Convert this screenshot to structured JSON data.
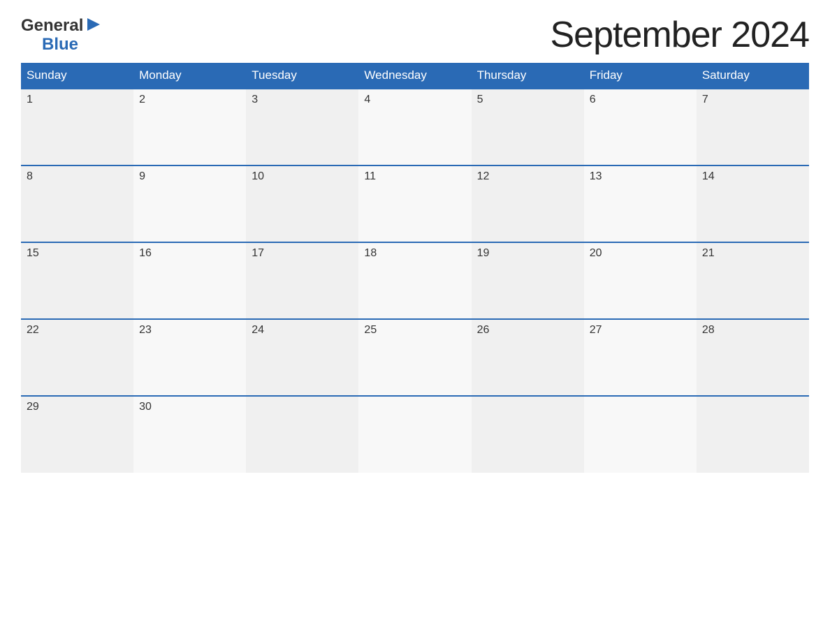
{
  "logo": {
    "general_text": "General",
    "blue_text": "Blue"
  },
  "title": "September 2024",
  "days_of_week": [
    "Sunday",
    "Monday",
    "Tuesday",
    "Wednesday",
    "Thursday",
    "Friday",
    "Saturday"
  ],
  "weeks": [
    [
      {
        "date": "1",
        "empty": false
      },
      {
        "date": "2",
        "empty": false
      },
      {
        "date": "3",
        "empty": false
      },
      {
        "date": "4",
        "empty": false
      },
      {
        "date": "5",
        "empty": false
      },
      {
        "date": "6",
        "empty": false
      },
      {
        "date": "7",
        "empty": false
      }
    ],
    [
      {
        "date": "8",
        "empty": false
      },
      {
        "date": "9",
        "empty": false
      },
      {
        "date": "10",
        "empty": false
      },
      {
        "date": "11",
        "empty": false
      },
      {
        "date": "12",
        "empty": false
      },
      {
        "date": "13",
        "empty": false
      },
      {
        "date": "14",
        "empty": false
      }
    ],
    [
      {
        "date": "15",
        "empty": false
      },
      {
        "date": "16",
        "empty": false
      },
      {
        "date": "17",
        "empty": false
      },
      {
        "date": "18",
        "empty": false
      },
      {
        "date": "19",
        "empty": false
      },
      {
        "date": "20",
        "empty": false
      },
      {
        "date": "21",
        "empty": false
      }
    ],
    [
      {
        "date": "22",
        "empty": false
      },
      {
        "date": "23",
        "empty": false
      },
      {
        "date": "24",
        "empty": false
      },
      {
        "date": "25",
        "empty": false
      },
      {
        "date": "26",
        "empty": false
      },
      {
        "date": "27",
        "empty": false
      },
      {
        "date": "28",
        "empty": false
      }
    ],
    [
      {
        "date": "29",
        "empty": false
      },
      {
        "date": "30",
        "empty": false
      },
      {
        "date": "",
        "empty": true
      },
      {
        "date": "",
        "empty": true
      },
      {
        "date": "",
        "empty": true
      },
      {
        "date": "",
        "empty": true
      },
      {
        "date": "",
        "empty": true
      }
    ]
  ]
}
